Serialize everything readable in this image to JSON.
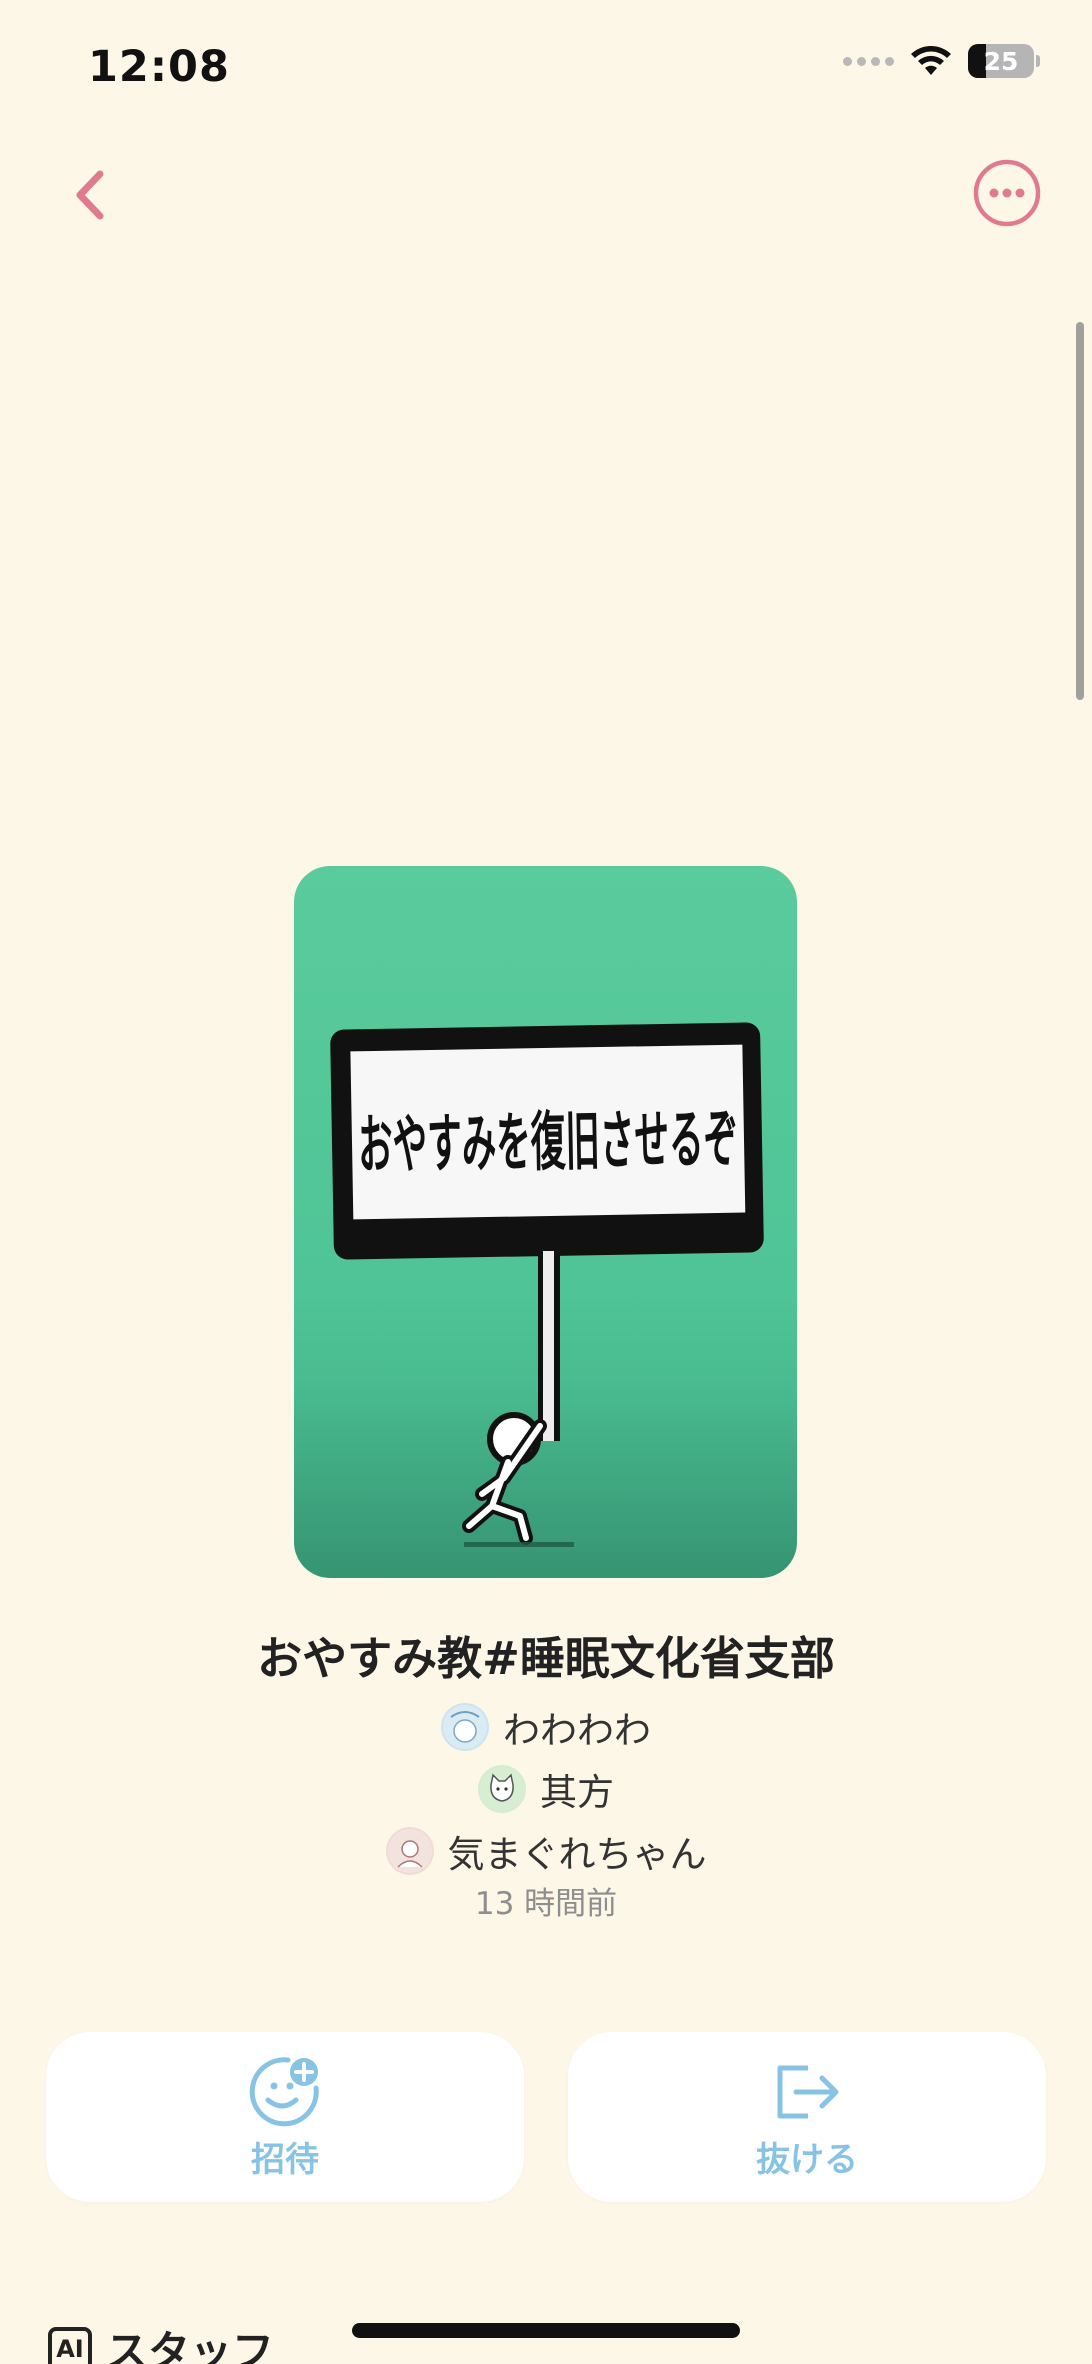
{
  "status_bar": {
    "time": "12:08",
    "battery": "25",
    "icons": [
      "cellular-signal-icon",
      "wifi-icon",
      "battery-icon"
    ]
  },
  "nav": {
    "back_icon": "chevron-left-icon",
    "more_icon": "ellipsis-circle-icon",
    "accent_color": "#e07a8e"
  },
  "cover": {
    "sign_text": "おやすみを復旧させるぞ",
    "background_color": "#52c797"
  },
  "group": {
    "title": "おやすみ教#睡眠文化省支部",
    "members": [
      {
        "name": "わわわわ",
        "avatar_color": "#cfe3ee"
      },
      {
        "name": "其方",
        "avatar_color": "#d5ecd0"
      },
      {
        "name": "気まぐれちゃん",
        "avatar_color": "#f0dcd6"
      }
    ],
    "time_ago": "13 時間前"
  },
  "actions": {
    "invite": {
      "label": "招待",
      "icon": "add-person-smile-icon"
    },
    "leave": {
      "label": "抜ける",
      "icon": "exit-arrow-icon"
    },
    "color": "#86c3e5"
  },
  "staff": {
    "badge": "AI",
    "title": "スタッフ"
  }
}
